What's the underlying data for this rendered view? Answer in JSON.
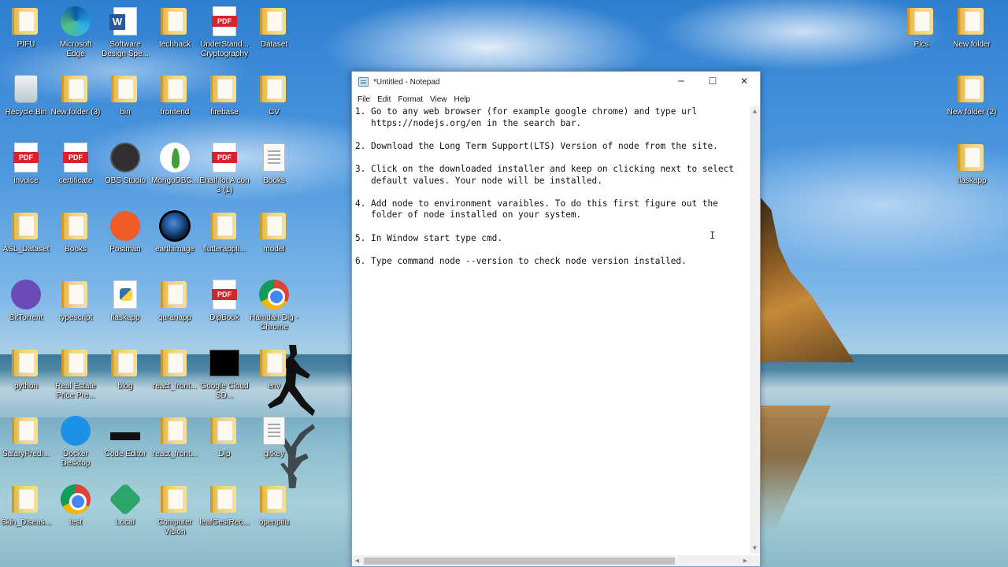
{
  "desktop": {
    "icons": [
      {
        "label": "PIFU",
        "icon": "folder-icon"
      },
      {
        "label": "Microsoft Edge",
        "icon": "edge-icon"
      },
      {
        "label": "Software Design Spe...",
        "icon": "word-document-icon"
      },
      {
        "label": "techhack",
        "icon": "folder-icon"
      },
      {
        "label": "UnderStand... Cryptography",
        "icon": "pdf-icon"
      },
      {
        "label": "Dataset",
        "icon": "folder-icon"
      },
      {
        "label": "Recycle Bin",
        "icon": "recycle-bin-icon"
      },
      {
        "label": "New folder (3)",
        "icon": "folder-icon"
      },
      {
        "label": "bin",
        "icon": "folder-icon"
      },
      {
        "label": "frontend",
        "icon": "folder-icon"
      },
      {
        "label": "firebase",
        "icon": "folder-icon"
      },
      {
        "label": "CV",
        "icon": "folder-icon"
      },
      {
        "label": "invoice",
        "icon": "pdf-icon"
      },
      {
        "label": "certificate",
        "icon": "pdf-icon"
      },
      {
        "label": "OBS Studio",
        "icon": "obs-studio-icon"
      },
      {
        "label": "MongoDBC...",
        "icon": "mongodb-compass-icon"
      },
      {
        "label": "Ehalf lot A con 3 (1)",
        "icon": "pdf-icon"
      },
      {
        "label": "Books",
        "icon": "document-icon"
      },
      {
        "label": "ASL_Dataset",
        "icon": "folder-icon"
      },
      {
        "label": "Books",
        "icon": "folder-icon"
      },
      {
        "label": "Postman",
        "icon": "postman-icon"
      },
      {
        "label": "earthimage",
        "icon": "image-icon"
      },
      {
        "label": "flutterappli...",
        "icon": "folder-icon"
      },
      {
        "label": "model",
        "icon": "folder-icon"
      },
      {
        "label": "BitTorrent",
        "icon": "bittorrent-icon"
      },
      {
        "label": "typescript",
        "icon": "folder-icon"
      },
      {
        "label": "flaskapp",
        "icon": "python-file-icon"
      },
      {
        "label": "quranapp",
        "icon": "folder-icon"
      },
      {
        "label": "DipBook",
        "icon": "pdf-icon"
      },
      {
        "label": "Hamdan Dig - Chrome",
        "icon": "chrome-icon"
      },
      {
        "label": "python",
        "icon": "folder-icon"
      },
      {
        "label": "Real Estate Price Pre...",
        "icon": "folder-icon"
      },
      {
        "label": "blog",
        "icon": "folder-icon"
      },
      {
        "label": "react_front...",
        "icon": "folder-icon"
      },
      {
        "label": "Google Cloud SD...",
        "icon": "terminal-icon"
      },
      {
        "label": "env",
        "icon": "folder-icon"
      },
      {
        "label": "SalaryPredi...",
        "icon": "folder-icon"
      },
      {
        "label": "Docker Desktop",
        "icon": "docker-icon"
      },
      {
        "label": "Code Editor",
        "icon": "code-editor-icon"
      },
      {
        "label": "react_front...",
        "icon": "folder-icon"
      },
      {
        "label": "Dip",
        "icon": "folder-icon"
      },
      {
        "label": "gitkey",
        "icon": "document-icon"
      },
      {
        "label": "Skin_Diseas...",
        "icon": "folder-icon"
      },
      {
        "label": "test",
        "icon": "chrome-icon"
      },
      {
        "label": "Local",
        "icon": "local-icon"
      },
      {
        "label": "Computer Vision",
        "icon": "folder-icon"
      },
      {
        "label": "leafGestRec...",
        "icon": "folder-icon"
      },
      {
        "label": "openpifu",
        "icon": "folder-icon"
      }
    ],
    "right_icons": [
      {
        "label": "Pics",
        "icon": "folder-icon"
      },
      {
        "label": "New folder",
        "icon": "folder-icon"
      },
      {
        "label": "New folder (2)",
        "icon": "folder-icon"
      },
      {
        "label": "flaskapp",
        "icon": "folder-icon"
      }
    ]
  },
  "notepad": {
    "title": "*Untitled - Notepad",
    "menu": [
      "File",
      "Edit",
      "Format",
      "View",
      "Help"
    ],
    "lines": [
      "1. Go to any web browser (for example google chrome) and type url",
      "   https://nodejs.org/en in the search bar.",
      "",
      "2. Download the Long Term Support(LTS) Version of node from the site.",
      "",
      "3. Click on the downloaded installer and keep on clicking next to select",
      "   default values. Your node will be installed.",
      "",
      "4. Add node to environment varaibles. To do this first figure out the",
      "   folder of node installed on your system.",
      "",
      "5. In Window start type cmd.",
      "",
      "6. Type command node --version to check node version installed."
    ],
    "window_buttons": {
      "minimize": "─",
      "maximize": "☐",
      "close": "✕"
    }
  }
}
